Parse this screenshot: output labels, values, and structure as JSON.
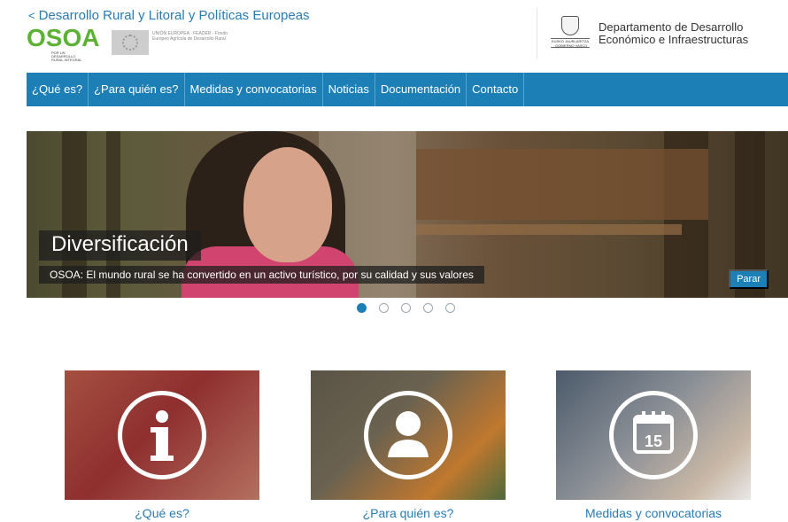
{
  "header": {
    "back_link": "Desarrollo Rural y Litoral y Políticas Europeas",
    "osoa_logo_text": "OSOA",
    "osoa_logo_sub": "POR UN DESARROLLO RURAL INTEGRAL",
    "eu_logo_text": "UNIÓN EUROPEA · FEADER · Fondo Europeo Agrícola de Desarrollo Rural",
    "gov_logo_text": "EUSKO JAURLARITZA · GOBIERNO VASCO",
    "department": "Departamento de Desarrollo Económico e Infraestructuras"
  },
  "nav": {
    "items": [
      {
        "label": "¿Qué es?"
      },
      {
        "label": "¿Para quién es?"
      },
      {
        "label": "Medidas y convocatorias"
      },
      {
        "label": "Noticias"
      },
      {
        "label": "Documentación"
      },
      {
        "label": "Contacto"
      }
    ]
  },
  "slider": {
    "title": "Diversificación",
    "caption": "OSOA: El mundo rural se ha convertido en un activo turístico, por su calidad y sus valores",
    "pause_label": "Parar",
    "slide_count": 5,
    "active_index": 0
  },
  "cards": [
    {
      "label": "¿Qué es?",
      "icon": "info-icon"
    },
    {
      "label": "¿Para quién es?",
      "icon": "person-icon"
    },
    {
      "label": "Medidas y convocatorias",
      "icon": "calendar-icon",
      "calendar_number": "15"
    }
  ],
  "colors": {
    "nav_blue": "#1c7fb5",
    "link_blue": "#2a7bb0",
    "osoa_green": "#5bb234"
  }
}
